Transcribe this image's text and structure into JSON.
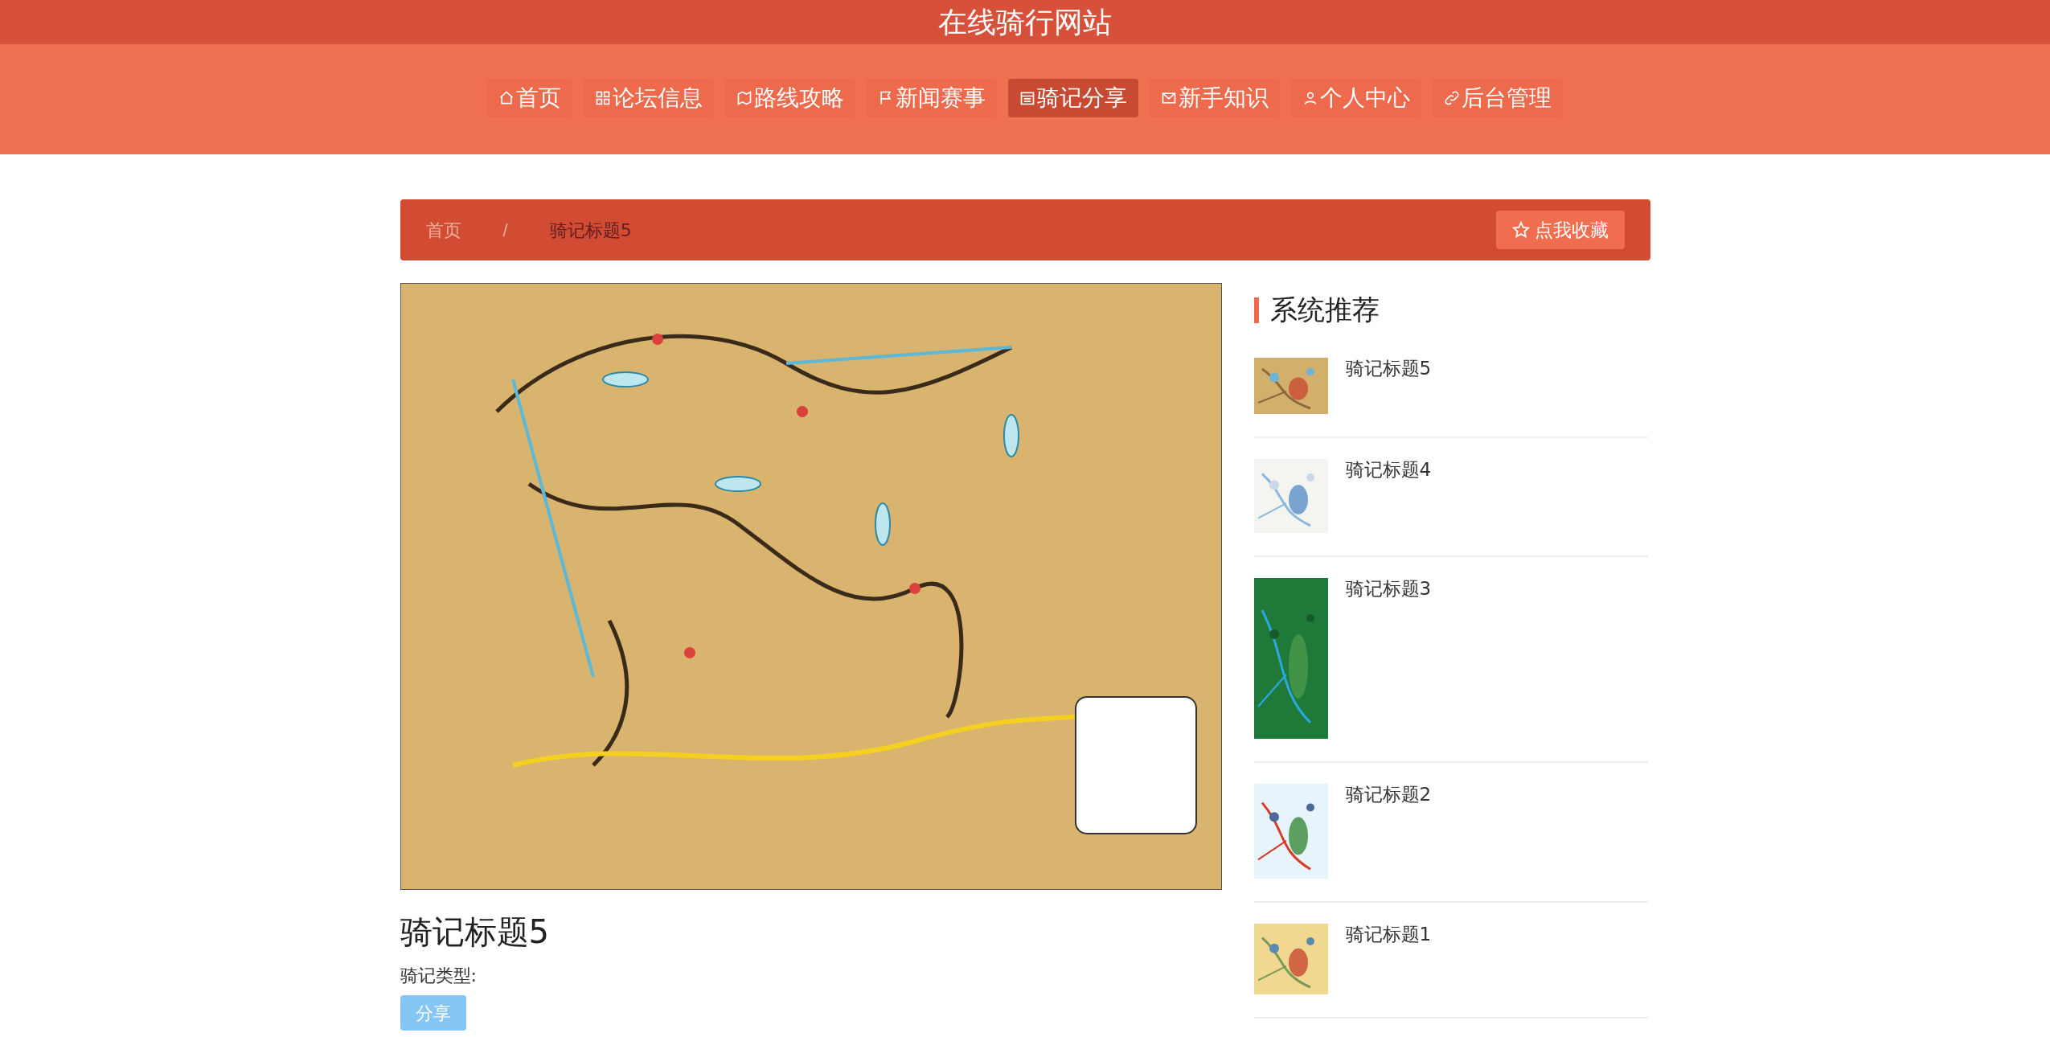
{
  "site_title": "在线骑行网站",
  "nav": [
    {
      "label": "首页",
      "selected": false
    },
    {
      "label": "论坛信息",
      "selected": false
    },
    {
      "label": "路线攻略",
      "selected": false
    },
    {
      "label": "新闻赛事",
      "selected": false
    },
    {
      "label": "骑记分享",
      "selected": true
    },
    {
      "label": "新手知识",
      "selected": false
    },
    {
      "label": "个人中心",
      "selected": false
    },
    {
      "label": "后台管理",
      "selected": false
    }
  ],
  "breadcrumb": [
    "首页",
    "/",
    "骑记标题5"
  ],
  "favorite_button": "点我收藏",
  "article": {
    "title": "骑记标题5",
    "type_label": "骑记类型:",
    "tag_button": "分享"
  },
  "sidebar": {
    "heading": "系统推荐",
    "items": [
      {
        "title": "骑记标题5"
      },
      {
        "title": "骑记标题4"
      },
      {
        "title": "骑记标题3"
      },
      {
        "title": "骑记标题2"
      },
      {
        "title": "骑记标题1"
      }
    ]
  }
}
